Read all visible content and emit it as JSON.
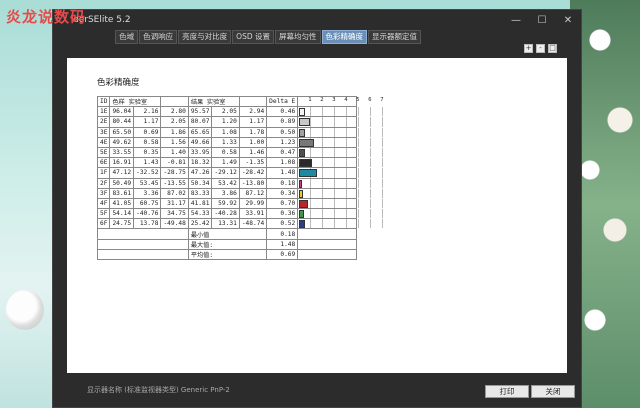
{
  "watermark": "炎龙说数码",
  "window": {
    "title": "derSElite 5.2",
    "controls": [
      "—",
      "☐",
      "✕"
    ]
  },
  "tabs": [
    "色域",
    "色调响应",
    "亮度与对比度",
    "OSD 设置",
    "屏幕均匀性",
    "色彩精确度",
    "显示器额定值"
  ],
  "active_tab": 5,
  "panel": {
    "title": "色彩精确度",
    "headers": {
      "id": "ID",
      "color": "色样",
      "lab1": "实验室",
      "result": "结果",
      "lab2": "实验室",
      "delta": "Delta E",
      "scale": [
        "1",
        "2",
        "3",
        "4",
        "5",
        "6",
        "7"
      ]
    },
    "rows": [
      {
        "id": "1E",
        "a": [
          "96.04",
          "2.16",
          "2.80"
        ],
        "b": [
          "95.57",
          "2.05",
          "2.94"
        ],
        "delta": "0.46",
        "de": 0.46,
        "color": "#f4f4f4"
      },
      {
        "id": "2E",
        "a": [
          "80.44",
          "1.17",
          "2.05"
        ],
        "b": [
          "80.07",
          "1.20",
          "1.17"
        ],
        "delta": "0.89",
        "de": 0.89,
        "color": "#c8c8c8"
      },
      {
        "id": "3E",
        "a": [
          "65.50",
          "0.69",
          "1.86"
        ],
        "b": [
          "65.65",
          "1.08",
          "1.78"
        ],
        "delta": "0.50",
        "de": 0.5,
        "color": "#a0a0a0"
      },
      {
        "id": "4E",
        "a": [
          "49.62",
          "0.58",
          "1.56"
        ],
        "b": [
          "49.66",
          "1.33",
          "1.00"
        ],
        "delta": "1.23",
        "de": 1.23,
        "color": "#787878"
      },
      {
        "id": "5E",
        "a": [
          "33.55",
          "0.35",
          "1.40"
        ],
        "b": [
          "33.95",
          "0.58",
          "1.46"
        ],
        "delta": "0.47",
        "de": 0.47,
        "color": "#505050"
      },
      {
        "id": "6E",
        "a": [
          "16.91",
          "1.43",
          "-0.81"
        ],
        "b": [
          "18.32",
          "1.49",
          "-1.35"
        ],
        "delta": "1.08",
        "de": 1.08,
        "color": "#2a2a2a"
      },
      {
        "id": "1F",
        "a": [
          "47.12",
          "-32.52",
          "-28.75"
        ],
        "b": [
          "47.26",
          "-29.12",
          "-28.42"
        ],
        "delta": "1.48",
        "de": 1.48,
        "color": "#1c8aa3"
      },
      {
        "id": "2F",
        "a": [
          "50.49",
          "53.45",
          "-13.55"
        ],
        "b": [
          "50.34",
          "53.42",
          "-13.80"
        ],
        "delta": "0.18",
        "de": 0.18,
        "color": "#c0418e"
      },
      {
        "id": "3F",
        "a": [
          "83.61",
          "3.36",
          "87.02"
        ],
        "b": [
          "83.33",
          "3.86",
          "87.12"
        ],
        "delta": "0.34",
        "de": 0.34,
        "color": "#e6cf2f"
      },
      {
        "id": "4F",
        "a": [
          "41.05",
          "60.75",
          "31.17"
        ],
        "b": [
          "41.81",
          "59.92",
          "29.99"
        ],
        "delta": "0.70",
        "de": 0.7,
        "color": "#b8262e"
      },
      {
        "id": "5F",
        "a": [
          "54.14",
          "-40.76",
          "34.75"
        ],
        "b": [
          "54.33",
          "-40.28",
          "33.91"
        ],
        "delta": "0.36",
        "de": 0.36,
        "color": "#3e9a4a"
      },
      {
        "id": "6F",
        "a": [
          "24.75",
          "13.78",
          "-49.48"
        ],
        "b": [
          "25.42",
          "13.31",
          "-48.74"
        ],
        "delta": "0.52",
        "de": 0.52,
        "color": "#2a3e8c"
      }
    ],
    "summary": [
      {
        "label": "最小值",
        "value": "0.18"
      },
      {
        "label": "最大值:",
        "value": "1.48"
      },
      {
        "label": "平均值:",
        "value": "0.69"
      }
    ]
  },
  "footer": {
    "label": "显示器名称 (标准监视器类型) Generic PnP-2"
  },
  "buttons": {
    "print": "打印",
    "close": "关闭"
  }
}
